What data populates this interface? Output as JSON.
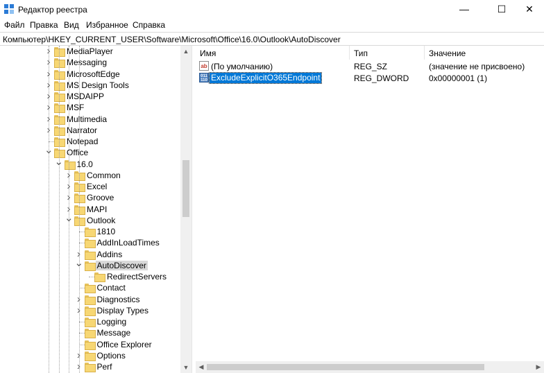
{
  "window": {
    "title": "Редактор реестра",
    "icon": "regedit-icon",
    "controls": {
      "minimize": "—",
      "maximize": "☐",
      "close": "✕"
    }
  },
  "menu": [
    "Файл",
    "Правка",
    "Вид",
    "Избранное",
    "Справка"
  ],
  "address": "Компьютер\\HKEY_CURRENT_USER\\Software\\Microsoft\\Office\\16.0\\Outlook\\AutoDiscover",
  "tree": [
    {
      "label": "MediaPlayer",
      "depth": 0,
      "expander": "collapsed"
    },
    {
      "label": "Messaging",
      "depth": 0,
      "expander": "collapsed"
    },
    {
      "label": "MicrosoftEdge",
      "depth": 0,
      "expander": "collapsed"
    },
    {
      "label": "MS Design Tools",
      "depth": 0,
      "expander": "collapsed"
    },
    {
      "label": "MSDAIPP",
      "depth": 0,
      "expander": "collapsed"
    },
    {
      "label": "MSF",
      "depth": 0,
      "expander": "collapsed"
    },
    {
      "label": "Multimedia",
      "depth": 0,
      "expander": "collapsed"
    },
    {
      "label": "Narrator",
      "depth": 0,
      "expander": "collapsed"
    },
    {
      "label": "Notepad",
      "depth": 0,
      "expander": "none"
    },
    {
      "label": "Office",
      "depth": 0,
      "expander": "expanded"
    },
    {
      "label": "16.0",
      "depth": 1,
      "expander": "expanded"
    },
    {
      "label": "Common",
      "depth": 2,
      "expander": "collapsed"
    },
    {
      "label": "Excel",
      "depth": 2,
      "expander": "collapsed"
    },
    {
      "label": "Groove",
      "depth": 2,
      "expander": "collapsed"
    },
    {
      "label": "MAPI",
      "depth": 2,
      "expander": "collapsed"
    },
    {
      "label": "Outlook",
      "depth": 2,
      "expander": "expanded"
    },
    {
      "label": "1810",
      "depth": 3,
      "expander": "none"
    },
    {
      "label": "AddInLoadTimes",
      "depth": 3,
      "expander": "none"
    },
    {
      "label": "Addins",
      "depth": 3,
      "expander": "collapsed"
    },
    {
      "label": "AutoDiscover",
      "depth": 3,
      "expander": "expanded",
      "selected": true
    },
    {
      "label": "RedirectServers",
      "depth": 4,
      "expander": "none"
    },
    {
      "label": "Contact",
      "depth": 3,
      "expander": "none"
    },
    {
      "label": "Diagnostics",
      "depth": 3,
      "expander": "collapsed"
    },
    {
      "label": "Display Types",
      "depth": 3,
      "expander": "collapsed"
    },
    {
      "label": "Logging",
      "depth": 3,
      "expander": "none"
    },
    {
      "label": "Message",
      "depth": 3,
      "expander": "none"
    },
    {
      "label": "Office Explorer",
      "depth": 3,
      "expander": "none"
    },
    {
      "label": "Options",
      "depth": 3,
      "expander": "collapsed"
    },
    {
      "label": "Perf",
      "depth": 3,
      "expander": "collapsed"
    }
  ],
  "list": {
    "columns": [
      "Имя",
      "Тип",
      "Значение"
    ],
    "rows": [
      {
        "name": "(По умолчанию)",
        "type": "REG_SZ",
        "value": "(значение не присвоено)",
        "icon": "reg-sz-icon",
        "icon_text": "ab"
      },
      {
        "name": "ExcludeExplicitO365Endpoint",
        "type": "REG_DWORD",
        "value": "0x00000001 (1)",
        "icon": "reg-dword-icon",
        "icon_text": "011 110",
        "selected": true
      }
    ]
  },
  "colors": {
    "selection": "#0078d7",
    "tree_selection": "#d9d9d9",
    "folder": "#f7d774"
  }
}
